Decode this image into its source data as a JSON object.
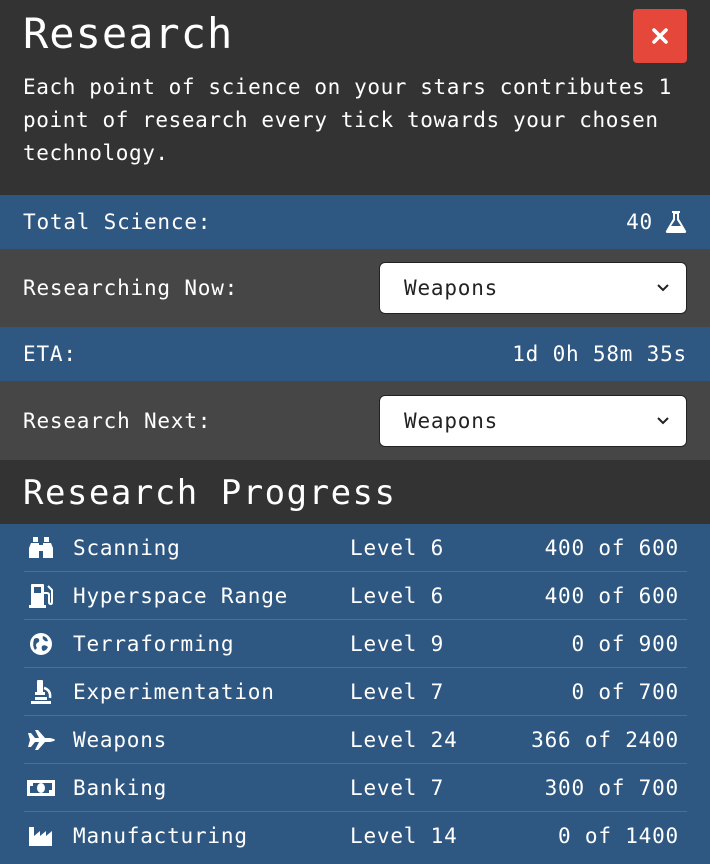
{
  "header": {
    "title": "Research",
    "description": "Each point of science on your stars contributes 1 point of research every tick towards your chosen technology.",
    "close_icon": "close-icon"
  },
  "total_science": {
    "label": "Total Science:",
    "value": "40",
    "icon": "flask-icon"
  },
  "researching_now": {
    "label": "Researching Now:",
    "selected": "Weapons"
  },
  "eta": {
    "label": "ETA:",
    "value": "1d 0h 58m 35s"
  },
  "research_next": {
    "label": "Research Next:",
    "selected": "Weapons"
  },
  "progress": {
    "title": "Research Progress",
    "techs": [
      {
        "name": "Scanning",
        "level": "Level 6",
        "progress": "400 of 600",
        "icon": "binoculars-icon"
      },
      {
        "name": "Hyperspace Range",
        "level": "Level 6",
        "progress": "400 of 600",
        "icon": "gas-pump-icon"
      },
      {
        "name": "Terraforming",
        "level": "Level 9",
        "progress": "0 of 900",
        "icon": "globe-icon"
      },
      {
        "name": "Experimentation",
        "level": "Level 7",
        "progress": "0 of 700",
        "icon": "microscope-icon"
      },
      {
        "name": "Weapons",
        "level": "Level 24",
        "progress": "366 of 2400",
        "icon": "fighter-jet-icon"
      },
      {
        "name": "Banking",
        "level": "Level 7",
        "progress": "300 of 700",
        "icon": "money-bill-icon"
      },
      {
        "name": "Manufacturing",
        "level": "Level 14",
        "progress": "0 of 1400",
        "icon": "industry-icon"
      }
    ]
  },
  "colors": {
    "background": "#333333",
    "blue_row": "#2e5882",
    "gray_row": "#464646",
    "close_button": "#e5473b"
  }
}
